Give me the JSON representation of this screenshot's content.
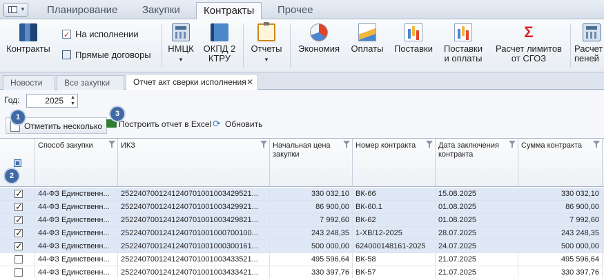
{
  "menu": {
    "tabs": [
      "Планирование",
      "Закупки",
      "Контракты",
      "Прочее"
    ],
    "active": "Контракты"
  },
  "ribbon": {
    "contracts": "Контракты",
    "in_execution": "На исполнении",
    "direct_contracts": "Прямые договоры",
    "nmck": "НМЦК",
    "okpd": "ОКПД 2 КТРУ",
    "reports": "Отчеты",
    "economy": "Экономия",
    "payments": "Оплаты",
    "deliveries": "Поставки",
    "deliveries_payments": "Поставки и оплаты",
    "calc_limits": "Расчет лимитов от СГОЗ",
    "calc_fines": "Расчет пеней"
  },
  "doc_tabs": [
    "Новости",
    "Все закупки",
    "Отчет акт сверки исполнения"
  ],
  "toolbar": {
    "year_label": "Год:",
    "year_value": "2025",
    "mark_several": "Отметить несколько",
    "build_excel": "Построить отчет в Excel",
    "refresh": "Обновить",
    "badges": [
      "1",
      "2",
      "3"
    ]
  },
  "table": {
    "columns": [
      "Способ закупки",
      "ИКЗ",
      "Начальная цена закупки",
      "Номер контракта",
      "Дата заключения контракта",
      "Сумма контракта"
    ],
    "rows": [
      {
        "checked": true,
        "method": "44-ФЗ Единственн...",
        "ikz": "2522407001241240701001003429521...",
        "price": "330 032,10",
        "num": "ВК-66",
        "date": "15.08.2025",
        "sum": "330 032,10"
      },
      {
        "checked": true,
        "method": "44-ФЗ Единственн...",
        "ikz": "2522407001241240701001003429921...",
        "price": "86 900,00",
        "num": "ВК-60.1",
        "date": "01.08.2025",
        "sum": "86 900,00"
      },
      {
        "checked": true,
        "method": "44-ФЗ Единственн...",
        "ikz": "2522407001241240701001003429821...",
        "price": "7 992,60",
        "num": "ВК-62",
        "date": "01.08.2025",
        "sum": "7 992,60"
      },
      {
        "checked": true,
        "method": "44-ФЗ Единственн...",
        "ikz": "2522407001241240701001000700100...",
        "price": "243 248,35",
        "num": "1-ХВ/12-2025",
        "date": "28.07.2025",
        "sum": "243 248,35"
      },
      {
        "checked": true,
        "method": "44-ФЗ Единственн...",
        "ikz": "2522407001241240701001000300161...",
        "price": "500 000,00",
        "num": "624000148161-2025",
        "date": "24.07.2025",
        "sum": "500 000,00"
      },
      {
        "checked": false,
        "method": "44-ФЗ Единственн...",
        "ikz": "2522407001241240701001003433521...",
        "price": "495 596,64",
        "num": "ВК-58",
        "date": "21.07.2025",
        "sum": "495 596,64"
      },
      {
        "checked": false,
        "method": "44-ФЗ Единственн...",
        "ikz": "2522407001241240701001003433421...",
        "price": "330 397,76",
        "num": "ВК-57",
        "date": "21.07.2025",
        "sum": "330 397,76"
      }
    ]
  },
  "colors": {
    "accent": "#3f6aa6",
    "selected_row": "#dfe8f6"
  }
}
